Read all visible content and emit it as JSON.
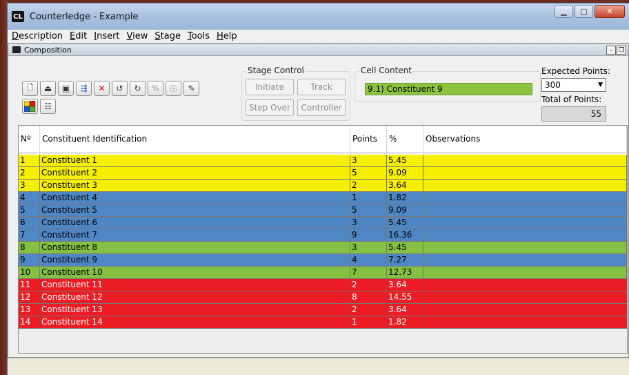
{
  "window": {
    "app_icon": "CL",
    "title": "Counterledge - Example"
  },
  "menu": [
    "Description",
    "Edit",
    "Insert",
    "View",
    "Stage",
    "Tools",
    "Help"
  ],
  "subwindow": {
    "title": "Composition"
  },
  "stage_control": {
    "legend": "Stage Control",
    "initiate": "Initiate",
    "track": "Track",
    "step_over": "Step Over",
    "controller": "Controller"
  },
  "cell_content": {
    "legend": "Cell Content",
    "value": "9.1) Constituent 9"
  },
  "expected_points": {
    "label": "Expected Points:",
    "value": "300"
  },
  "total_points": {
    "label": "Total of Points:",
    "value": "55"
  },
  "table": {
    "headers": [
      "Nº",
      "Constituent Identification",
      "Points",
      "%",
      "Observations"
    ],
    "rows": [
      {
        "n": "1",
        "name": "Constituent 1",
        "points": "3",
        "pct": "5.45",
        "obs": ""
      },
      {
        "n": "2",
        "name": "Constituent 2",
        "points": "5",
        "pct": "9.09",
        "obs": ""
      },
      {
        "n": "3",
        "name": "Constituent 3",
        "points": "2",
        "pct": "3.64",
        "obs": ""
      },
      {
        "n": "4",
        "name": "Constituent 4",
        "points": "1",
        "pct": "1.82",
        "obs": ""
      },
      {
        "n": "5",
        "name": "Constituent 5",
        "points": "5",
        "pct": "9.09",
        "obs": ""
      },
      {
        "n": "6",
        "name": "Constituent 6",
        "points": "3",
        "pct": "5.45",
        "obs": ""
      },
      {
        "n": "7",
        "name": "Constituent 7",
        "points": "9",
        "pct": "16.36",
        "obs": ""
      },
      {
        "n": "8",
        "name": "Constituent 8",
        "points": "3",
        "pct": "5.45",
        "obs": ""
      },
      {
        "n": "9",
        "name": "Constituent 9",
        "points": "4",
        "pct": "7.27",
        "obs": ""
      },
      {
        "n": "10",
        "name": "Constituent 10",
        "points": "7",
        "pct": "12.73",
        "obs": ""
      },
      {
        "n": "11",
        "name": "Constituent 11",
        "points": "2",
        "pct": "3.64",
        "obs": ""
      },
      {
        "n": "12",
        "name": "Constituent 12",
        "points": "8",
        "pct": "14.55",
        "obs": ""
      },
      {
        "n": "13",
        "name": "Constituent 13",
        "points": "2",
        "pct": "3.64",
        "obs": ""
      },
      {
        "n": "14",
        "name": "Constituent 14",
        "points": "1",
        "pct": "1.82",
        "obs": ""
      }
    ]
  },
  "colors": {
    "yellow": "#f7ef00",
    "blue": "#4f86c4",
    "green": "#84c041",
    "red": "#ec1c24"
  },
  "toolbar_icons": [
    "new-document-icon",
    "open-icon",
    "save-icon",
    "insert-constituent-icon",
    "delete-icon",
    "undo-icon",
    "redo-icon",
    "percent-icon",
    "export-icon",
    "edit-count-icon",
    "color-palette-icon",
    "list-icon"
  ]
}
